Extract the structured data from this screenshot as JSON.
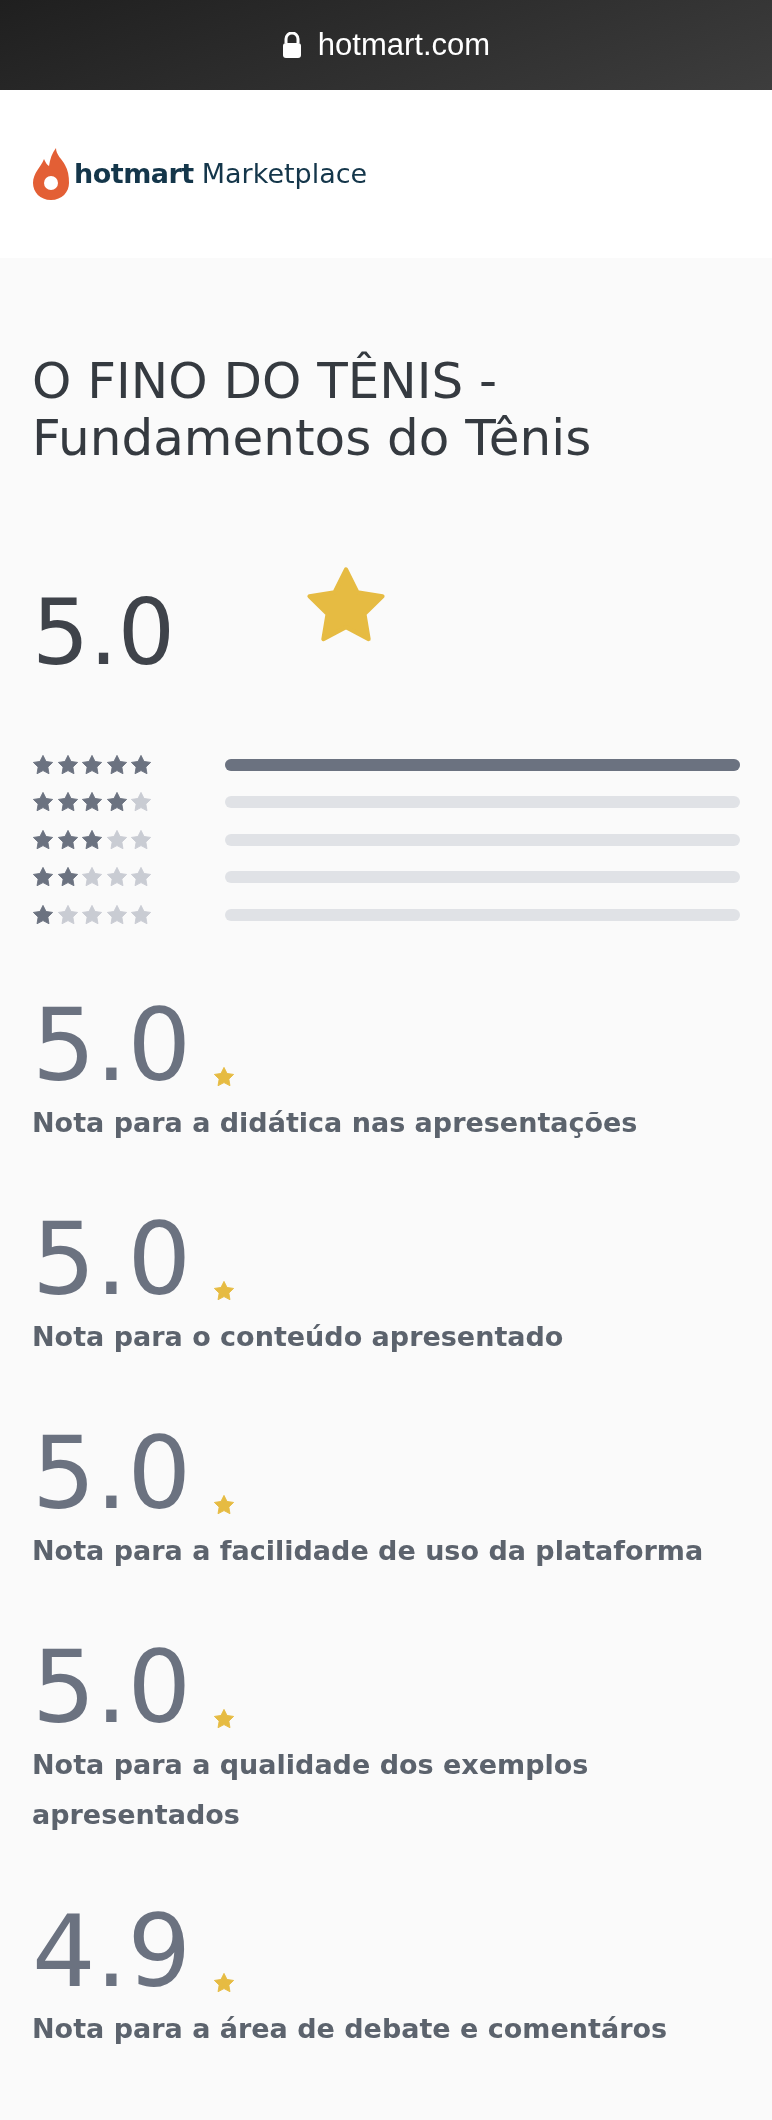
{
  "browser_bar": {
    "url": "hotmart.com"
  },
  "header": {
    "brand": "hotmart",
    "product": "Marketplace"
  },
  "title": "O FINO DO TÊNIS - Fundamentos do Tênis",
  "overall": {
    "score": "5.0"
  },
  "distribution": [
    {
      "stars": 5,
      "level": 1
    },
    {
      "stars": 4
    },
    {
      "stars": 3
    },
    {
      "stars": 2
    },
    {
      "stars": 1
    }
  ],
  "criteria": [
    {
      "score": "5.0",
      "label": "Nota para a didática nas apresentações"
    },
    {
      "score": "5.0",
      "label": "Nota para o conteúdo apresentado"
    },
    {
      "score": "5.0",
      "label": "Nota para a facilidade de uso da plataforma"
    },
    {
      "score": "5.0",
      "label": "Nota para a qualidade dos exemplos apresentados"
    },
    {
      "score": "4.9",
      "label": "Nota para a área de debate e comentáros"
    }
  ]
}
